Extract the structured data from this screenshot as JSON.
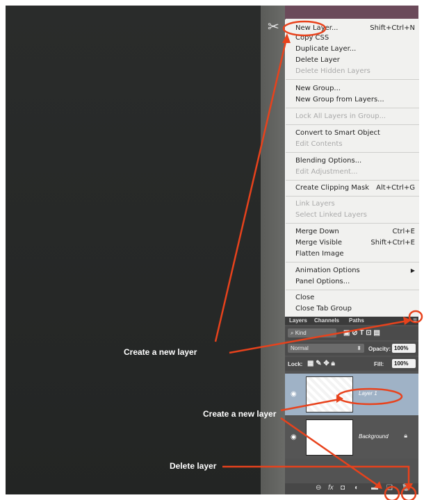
{
  "menu": {
    "items": [
      {
        "label": "New Layer...",
        "shortcut": "Shift+Ctrl+N",
        "disabled": false
      },
      {
        "label": "Copy CSS",
        "shortcut": "",
        "disabled": false
      },
      {
        "label": "Duplicate Layer...",
        "shortcut": "",
        "disabled": false
      },
      {
        "label": "Delete Layer",
        "shortcut": "",
        "disabled": false
      },
      {
        "label": "Delete Hidden Layers",
        "shortcut": "",
        "disabled": true
      },
      {
        "label": "New Group...",
        "shortcut": "",
        "disabled": false
      },
      {
        "label": "New Group from Layers...",
        "shortcut": "",
        "disabled": false
      },
      {
        "label": "Lock All Layers in Group...",
        "shortcut": "",
        "disabled": true
      },
      {
        "label": "Convert to Smart Object",
        "shortcut": "",
        "disabled": false
      },
      {
        "label": "Edit Contents",
        "shortcut": "",
        "disabled": true
      },
      {
        "label": "Blending Options...",
        "shortcut": "",
        "disabled": false
      },
      {
        "label": "Edit Adjustment...",
        "shortcut": "",
        "disabled": true
      },
      {
        "label": "Create Clipping Mask",
        "shortcut": "Alt+Ctrl+G",
        "disabled": false
      },
      {
        "label": "Link Layers",
        "shortcut": "",
        "disabled": true
      },
      {
        "label": "Select Linked Layers",
        "shortcut": "",
        "disabled": true
      },
      {
        "label": "Merge Down",
        "shortcut": "Ctrl+E",
        "disabled": false
      },
      {
        "label": "Merge Visible",
        "shortcut": "Shift+Ctrl+E",
        "disabled": false
      },
      {
        "label": "Flatten Image",
        "shortcut": "",
        "disabled": false
      },
      {
        "label": "Animation Options",
        "shortcut": "",
        "disabled": false
      },
      {
        "label": "Panel Options...",
        "shortcut": "",
        "disabled": false
      },
      {
        "label": "Close",
        "shortcut": "",
        "disabled": false
      },
      {
        "label": "Close Tab Group",
        "shortcut": "",
        "disabled": false
      }
    ]
  },
  "panel": {
    "tabs": [
      "Layers",
      "Channels",
      "Paths"
    ],
    "kind_label": "Kind",
    "blend_mode": "Normal",
    "opacity_label": "Opacity:",
    "opacity_value": "100%",
    "lock_label": "Lock:",
    "fill_label": "Fill:",
    "fill_value": "100%",
    "layers": [
      {
        "name": "Layer 1",
        "selected": true
      },
      {
        "name": "Background",
        "selected": false
      }
    ]
  },
  "callouts": {
    "new_layer_menu": "Create a new layer",
    "new_layer_button": "Create a new layer",
    "delete_layer": "Delete layer"
  },
  "colors": {
    "annotation": "#e8421c",
    "menu_bg": "#f1f1ef",
    "panel_bg": "#535353",
    "selected_layer": "#9fb2c6"
  },
  "icons": [
    "scissors-icon",
    "eye-icon",
    "lock-icon",
    "link-icon",
    "fx-icon",
    "mask-icon",
    "adjustment-icon",
    "folder-icon",
    "new-layer-icon",
    "trash-icon",
    "panel-menu-icon",
    "search-icon"
  ]
}
